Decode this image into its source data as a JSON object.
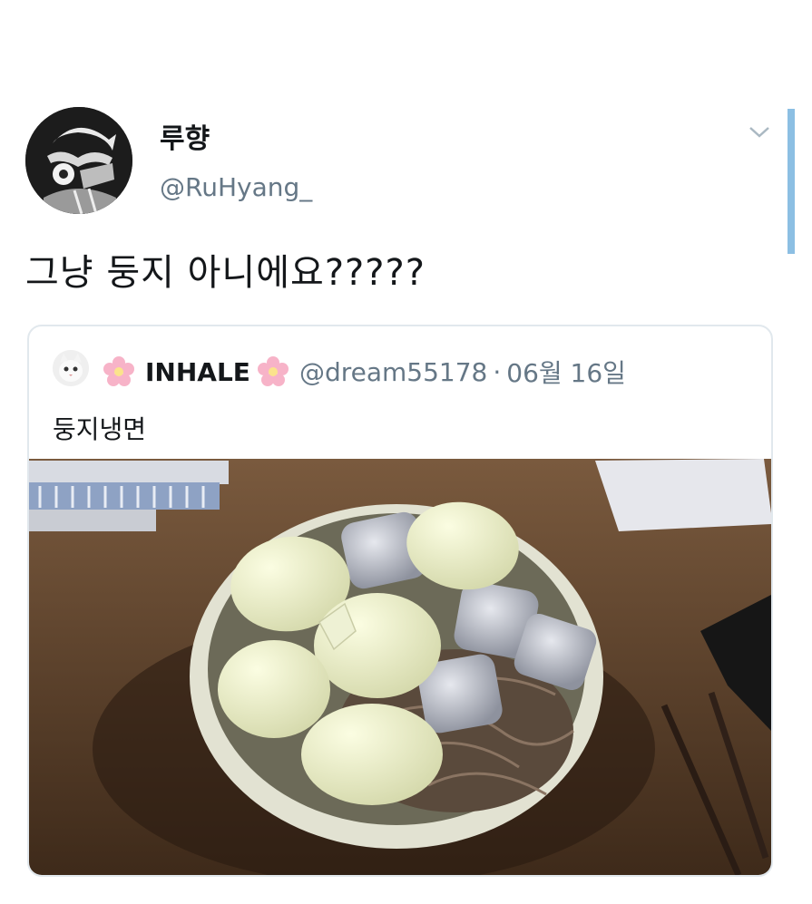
{
  "tweet": {
    "display_name": "루향",
    "handle": "@RuHyang_",
    "text": "그냥 둥지 아니에요?????",
    "avatar_icon": "avatar-illustration",
    "menu_icon": "chevron-down-icon"
  },
  "quoted": {
    "name": "INHALE",
    "handle": "@dream55178",
    "separator": "·",
    "date": "06월 16일",
    "text": "둥지냉면",
    "decoration_icon": "cherry-blossom-icon",
    "avatar_icon": "cat-avatar",
    "photo_icon": "cold-noodles-with-eggs-photo"
  },
  "colors": {
    "text": "#14171a",
    "secondary": "#657786",
    "border": "#e1e8ed",
    "scrollbar": "#8cbfe3"
  }
}
